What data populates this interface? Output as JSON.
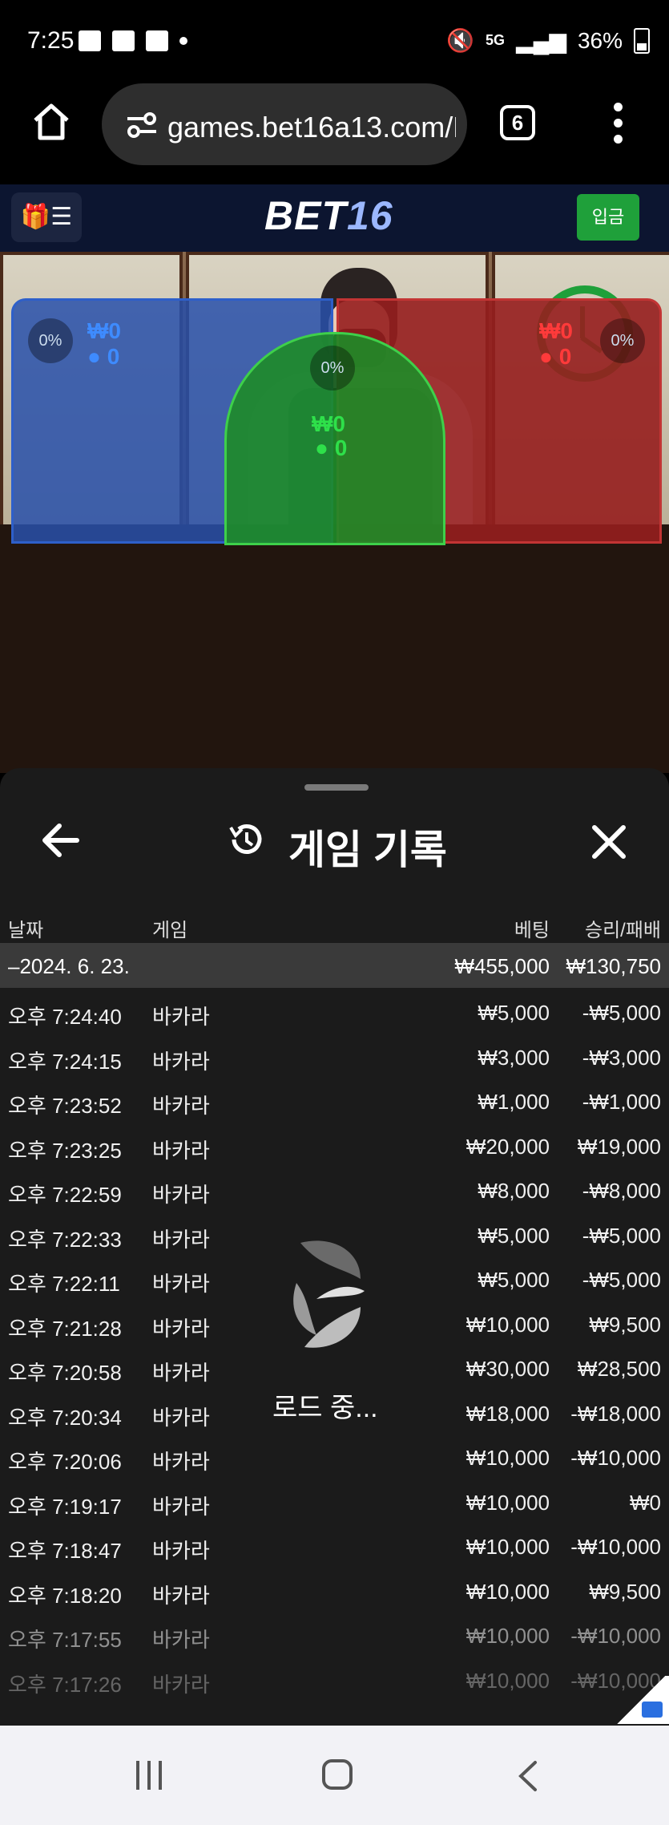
{
  "status_bar": {
    "time": "7:25",
    "network": "5G",
    "battery": "36%"
  },
  "browser": {
    "url": "games.bet16a13.com/L",
    "tab_count": "6"
  },
  "site": {
    "logo_main": "BET",
    "logo_num": "16",
    "deposit_label": "입금"
  },
  "table_zones": {
    "player": {
      "percent": "0%",
      "amount": "₩0",
      "count": "0"
    },
    "tie": {
      "percent": "0%",
      "amount": "₩0",
      "count": "0"
    },
    "banker": {
      "percent": "0%",
      "amount": "₩0",
      "count": "0"
    }
  },
  "history": {
    "title": "게임 기록",
    "columns": {
      "date": "날짜",
      "game": "게임",
      "bet": "베팅",
      "result": "승리/패배"
    },
    "date_group": {
      "date": "–2024. 6. 23.",
      "bet": "₩455,000",
      "result": "₩130,750"
    },
    "rows": [
      {
        "time": "오후 7:24:40",
        "game": "바카라",
        "bet": "₩5,000",
        "result": "-₩5,000"
      },
      {
        "time": "오후 7:24:15",
        "game": "바카라",
        "bet": "₩3,000",
        "result": "-₩3,000"
      },
      {
        "time": "오후 7:23:52",
        "game": "바카라",
        "bet": "₩1,000",
        "result": "-₩1,000"
      },
      {
        "time": "오후 7:23:25",
        "game": "바카라",
        "bet": "₩20,000",
        "result": "₩19,000"
      },
      {
        "time": "오후 7:22:59",
        "game": "바카라",
        "bet": "₩8,000",
        "result": "-₩8,000"
      },
      {
        "time": "오후 7:22:33",
        "game": "바카라",
        "bet": "₩5,000",
        "result": "-₩5,000"
      },
      {
        "time": "오후 7:22:11",
        "game": "바카라",
        "bet": "₩5,000",
        "result": "-₩5,000"
      },
      {
        "time": "오후 7:21:28",
        "game": "바카라",
        "bet": "₩10,000",
        "result": "₩9,500"
      },
      {
        "time": "오후 7:20:58",
        "game": "바카라",
        "bet": "₩30,000",
        "result": "₩28,500"
      },
      {
        "time": "오후 7:20:34",
        "game": "바카라",
        "bet": "₩18,000",
        "result": "-₩18,000"
      },
      {
        "time": "오후 7:20:06",
        "game": "바카라",
        "bet": "₩10,000",
        "result": "-₩10,000"
      },
      {
        "time": "오후 7:19:17",
        "game": "바카라",
        "bet": "₩10,000",
        "result": "₩0"
      },
      {
        "time": "오후 7:18:47",
        "game": "바카라",
        "bet": "₩10,000",
        "result": "-₩10,000"
      },
      {
        "time": "오후 7:18:20",
        "game": "바카라",
        "bet": "₩10,000",
        "result": "₩9,500"
      },
      {
        "time": "오후 7:17:55",
        "game": "바카라",
        "bet": "₩10,000",
        "result": "-₩10,000"
      },
      {
        "time": "오후 7:17:26",
        "game": "바카라",
        "bet": "₩10,000",
        "result": "-₩10,000"
      }
    ],
    "loading_text": "로드 중..."
  }
}
